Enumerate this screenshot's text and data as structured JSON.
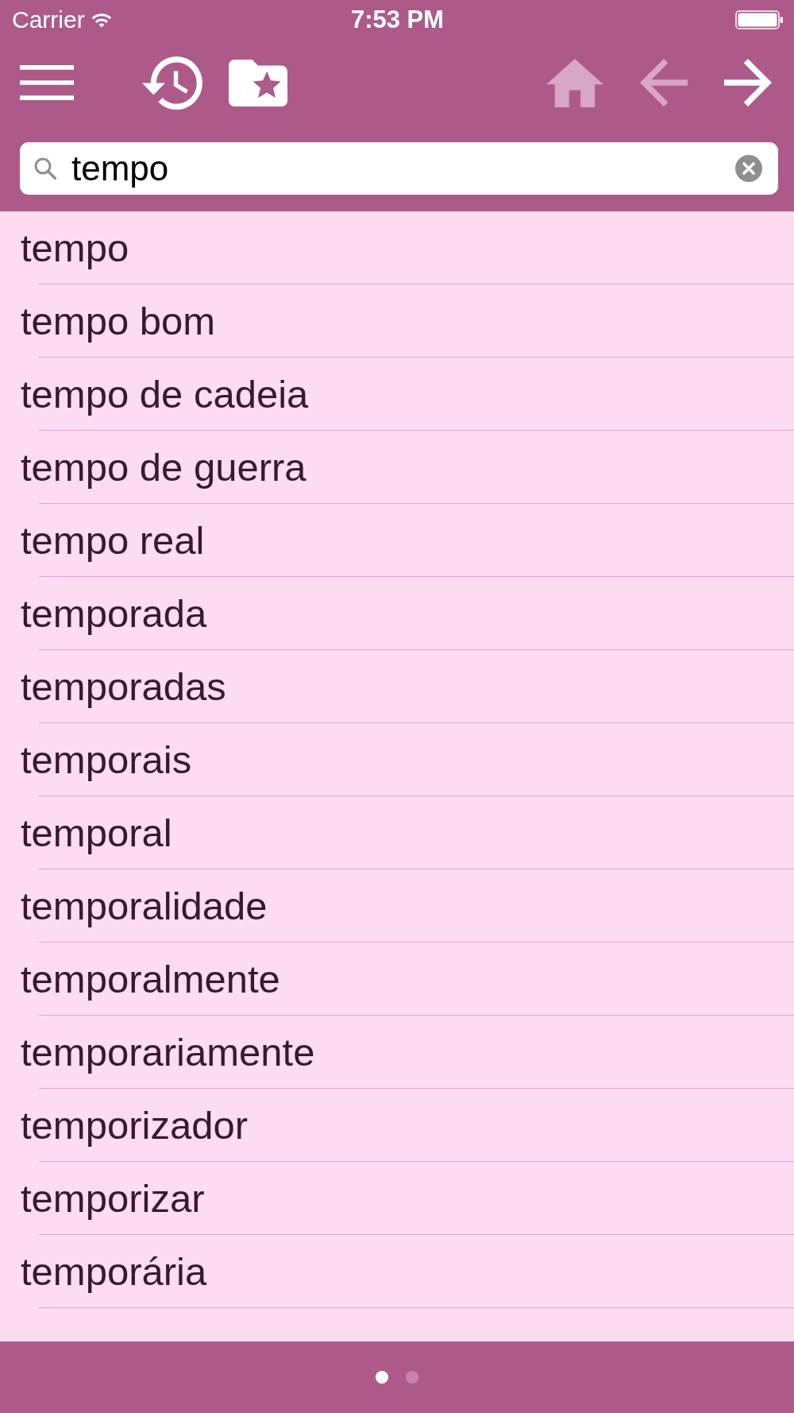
{
  "status_bar": {
    "carrier": "Carrier",
    "time": "7:53 PM"
  },
  "toolbar": {
    "buttons": [
      {
        "kind": "menu",
        "disabled": false
      },
      {
        "kind": "history",
        "disabled": false
      },
      {
        "kind": "favorites",
        "disabled": false
      },
      {
        "kind": "home",
        "disabled": true
      },
      {
        "kind": "back",
        "disabled": true
      },
      {
        "kind": "forward",
        "disabled": false
      }
    ]
  },
  "search": {
    "value": "tempo"
  },
  "results": [
    "tempo",
    "tempo bom",
    "tempo de cadeia",
    "tempo de guerra",
    "tempo real",
    "temporada",
    "temporadas",
    "temporais",
    "temporal",
    "temporalidade",
    "temporalmente",
    "temporariamente",
    "temporizador",
    "temporizar",
    "temporária"
  ],
  "page_dots": [
    {
      "selected": true
    },
    {
      "selected": false
    }
  ]
}
